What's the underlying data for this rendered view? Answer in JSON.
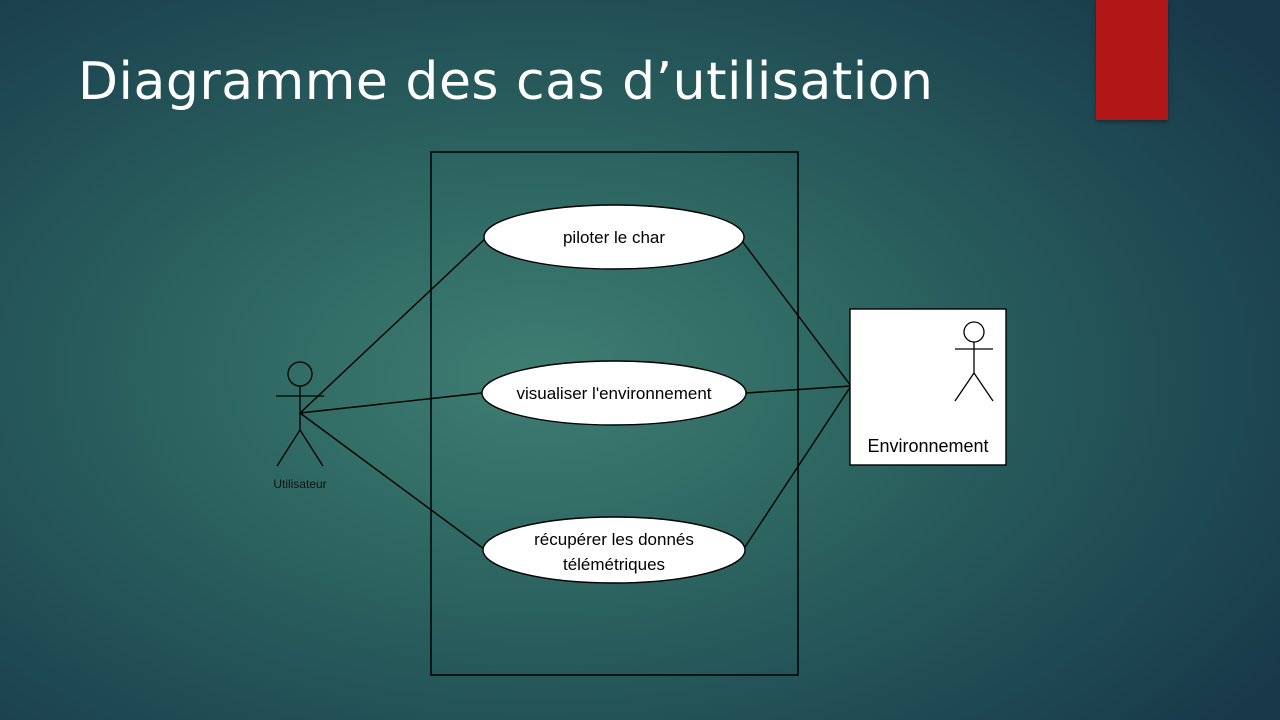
{
  "slide": {
    "title": "Diagramme des cas d’utilisation",
    "accent_color": "#b01716"
  },
  "diagram": {
    "type": "uml-use-case",
    "actors": [
      {
        "id": "utilisateur",
        "label": "Utilisateur"
      },
      {
        "id": "environnement",
        "label": "Environnement"
      }
    ],
    "use_cases": [
      {
        "id": "piloter",
        "lines": [
          "piloter le char"
        ]
      },
      {
        "id": "visualiser",
        "lines": [
          "visualiser l'environnement"
        ]
      },
      {
        "id": "recuperer",
        "lines": [
          "récupérer les donnés",
          "télémétriques"
        ]
      }
    ],
    "associations": [
      {
        "from": "utilisateur",
        "to": "piloter"
      },
      {
        "from": "utilisateur",
        "to": "visualiser"
      },
      {
        "from": "utilisateur",
        "to": "recuperer"
      },
      {
        "from": "environnement",
        "to": "piloter"
      },
      {
        "from": "environnement",
        "to": "visualiser"
      },
      {
        "from": "environnement",
        "to": "recuperer"
      }
    ]
  }
}
